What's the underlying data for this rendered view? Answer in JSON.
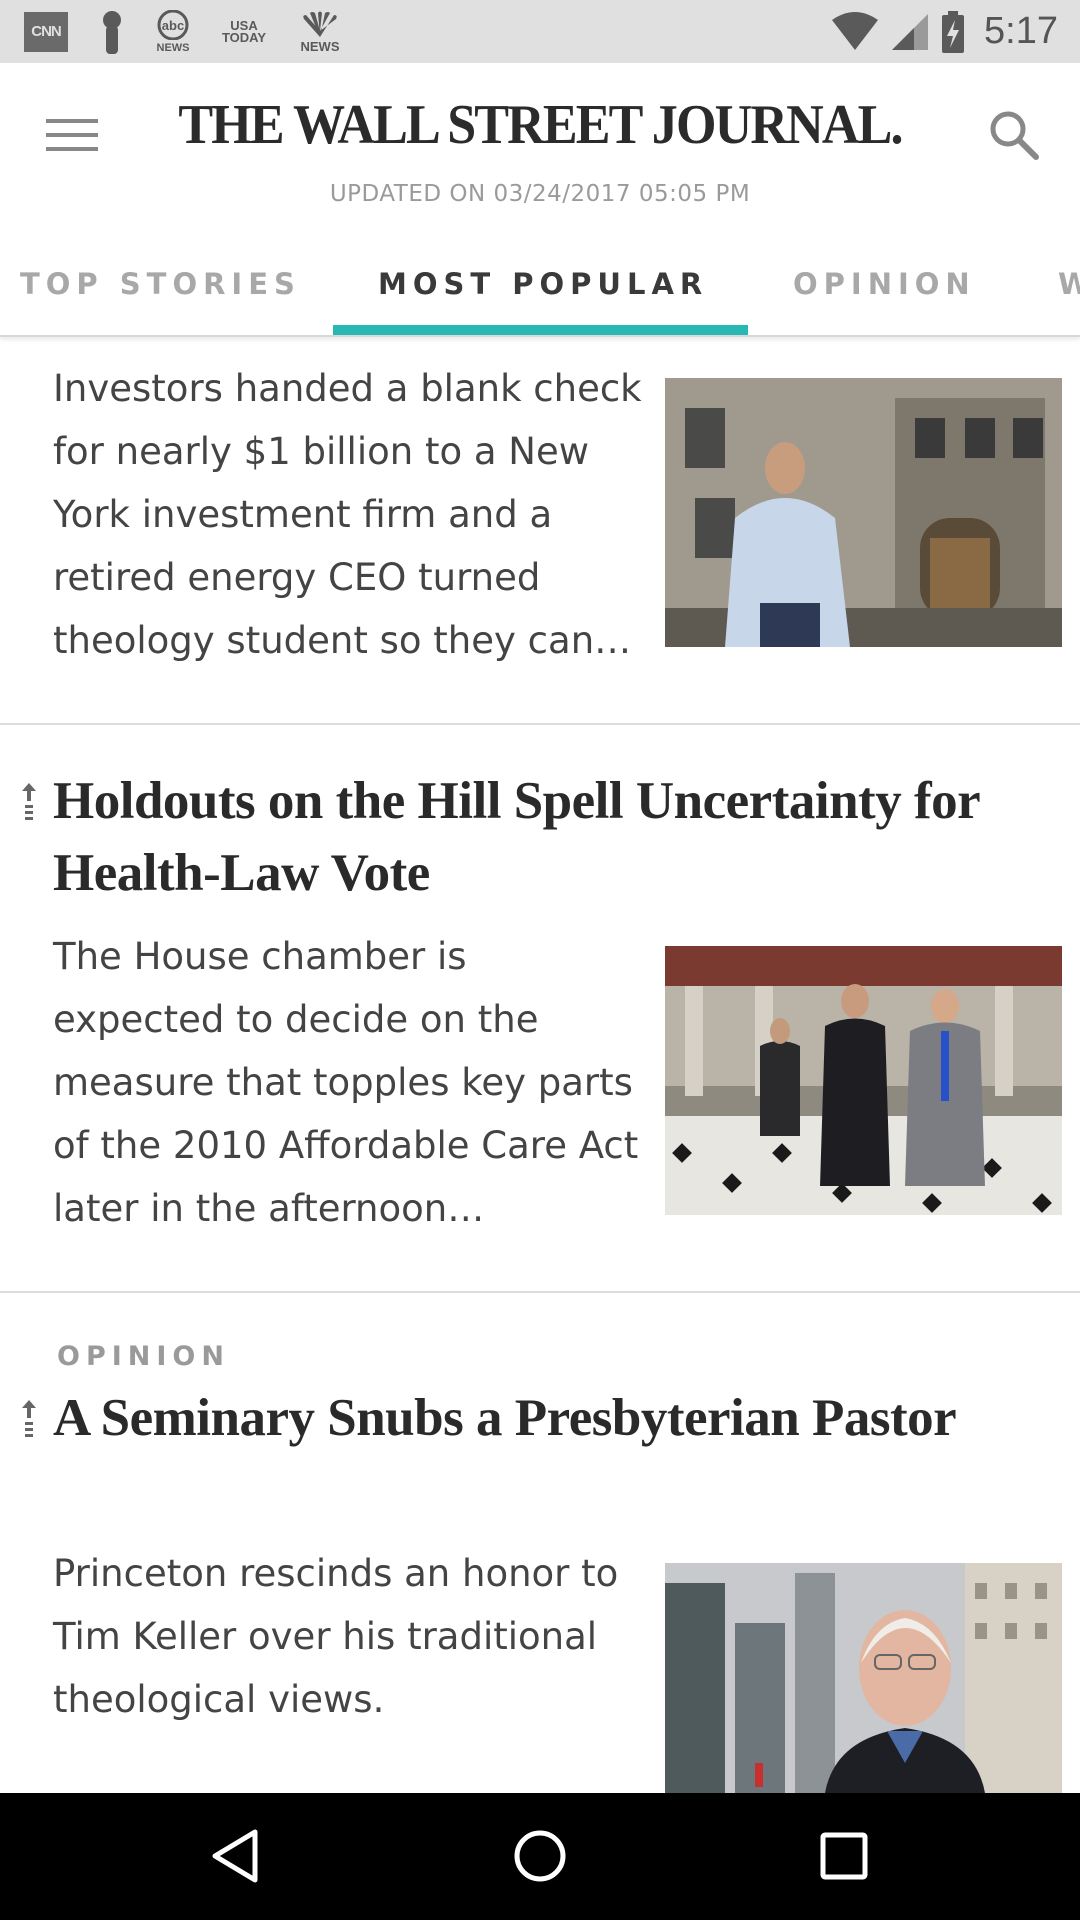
{
  "status_bar": {
    "time": "5:17",
    "notifications": [
      {
        "name": "cnn-icon",
        "label": "CNN"
      },
      {
        "name": "podcast-icon",
        "label": ""
      },
      {
        "name": "abc-news-icon",
        "label": "abc NEWS"
      },
      {
        "name": "usa-today-icon",
        "label": "USA TODAY"
      },
      {
        "name": "nbc-news-icon",
        "label": "NEWS"
      }
    ]
  },
  "header": {
    "title": "THE WALL STREET JOURNAL.",
    "updated": "UPDATED ON 03/24/2017 05:05 PM"
  },
  "tabs": [
    {
      "label": "TOP STORIES",
      "active": false
    },
    {
      "label": "MOST POPULAR",
      "active": true
    },
    {
      "label": "OPINION",
      "active": false
    },
    {
      "label": "W",
      "active": false
    }
  ],
  "articles": [
    {
      "summary": "Investors handed a blank check for nearly $1 billion to a New York investment firm and a retired energy CEO turned theology student so they can…"
    },
    {
      "headline": "Holdouts on the Hill Spell Uncertainty for Health-Law Vote",
      "summary": "The House chamber is expected to decide on the measure that topples key parts of the 2010 Affordable Care Act later in the afternoon…"
    },
    {
      "flag": "OPINION",
      "headline": "A Seminary Snubs a Presbyterian Pastor",
      "summary": "Princeton rescinds an honor to Tim Keller over his traditional theological views."
    }
  ],
  "colors": {
    "accent": "#27b8b4",
    "status_bar": "#e0e0e0",
    "nav_bar": "#000000"
  }
}
